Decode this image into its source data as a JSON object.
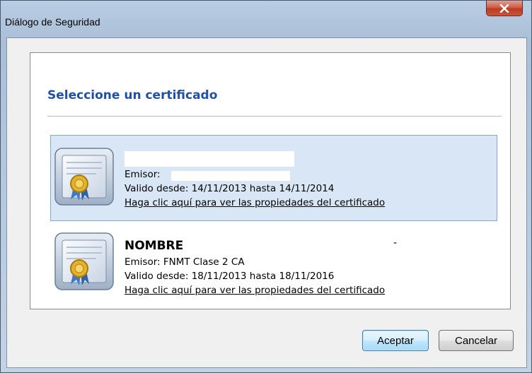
{
  "window": {
    "title": "Diálogo de Seguridad"
  },
  "panel": {
    "heading": "Seleccione un certificado"
  },
  "certificates": [
    {
      "name": "",
      "issuer": "Emisor:",
      "validity": "Valido desde: 14/11/2013 hasta 14/11/2014",
      "link": "Haga clic aquí para ver las propiedades del certificado",
      "selected": true
    },
    {
      "name": "NOMBRE",
      "name_suffix": "-",
      "issuer": "Emisor: FNMT Clase 2 CA",
      "validity": "Valido desde: 18/11/2013 hasta 18/11/2016",
      "link": "Haga clic aquí para ver las propiedades del certificado",
      "selected": false
    }
  ],
  "buttons": {
    "accept": "Aceptar",
    "cancel": "Cancelar"
  },
  "colors": {
    "heading": "#1f4fa8",
    "selection_bg": "#d8e6f6",
    "selection_border": "#7fa9d6",
    "close_button": "#c9553c"
  },
  "icons": {
    "close": "close-icon",
    "certificate": "certificate-icon"
  }
}
